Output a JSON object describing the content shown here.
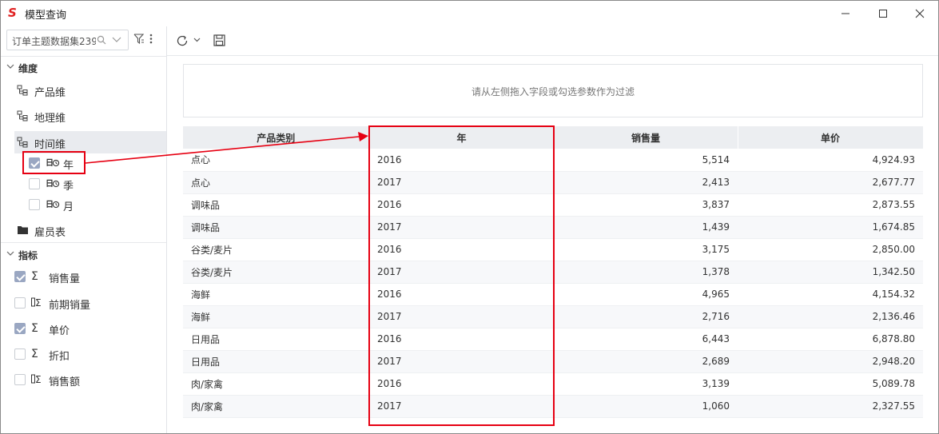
{
  "window": {
    "title": "模型查询",
    "logo_text": "S",
    "accent": "#e02020"
  },
  "left": {
    "search": {
      "value": "订单主题数据集239"
    },
    "dimensions": {
      "header": "维度",
      "items": [
        {
          "label": "产品维",
          "icon": "hierarchy-icon"
        },
        {
          "label": "地理维",
          "icon": "hierarchy-icon"
        },
        {
          "label": "时间维",
          "icon": "hierarchy-icon",
          "selected": true
        }
      ],
      "time_fields": [
        {
          "label": "年",
          "checked": true
        },
        {
          "label": "季",
          "checked": false
        },
        {
          "label": "月",
          "checked": false
        }
      ],
      "folder": {
        "label": "雇员表",
        "icon": "folder-icon"
      }
    },
    "measures": {
      "header": "指标",
      "items": [
        {
          "label": "销售量",
          "checked": true,
          "icon": "sigma-icon"
        },
        {
          "label": "前期销量",
          "checked": false,
          "icon": "calc-sigma-icon"
        },
        {
          "label": "单价",
          "checked": true,
          "icon": "sigma-icon"
        },
        {
          "label": "折扣",
          "checked": false,
          "icon": "sigma-icon"
        },
        {
          "label": "销售额",
          "checked": false,
          "icon": "calc-sigma-icon"
        }
      ]
    }
  },
  "filter": {
    "hint": "请从左侧拖入字段或勾选参数作为过滤"
  },
  "table": {
    "headers": [
      "产品类别",
      "年",
      "销售量",
      "单价"
    ],
    "rows": [
      [
        "点心",
        "2016",
        "5,514",
        "4,924.93"
      ],
      [
        "点心",
        "2017",
        "2,413",
        "2,677.77"
      ],
      [
        "调味品",
        "2016",
        "3,837",
        "2,873.55"
      ],
      [
        "调味品",
        "2017",
        "1,439",
        "1,674.85"
      ],
      [
        "谷类/麦片",
        "2016",
        "3,175",
        "2,850.00"
      ],
      [
        "谷类/麦片",
        "2017",
        "1,378",
        "1,342.50"
      ],
      [
        "海鲜",
        "2016",
        "4,965",
        "4,154.32"
      ],
      [
        "海鲜",
        "2017",
        "2,716",
        "2,136.46"
      ],
      [
        "日用品",
        "2016",
        "6,443",
        "6,878.80"
      ],
      [
        "日用品",
        "2017",
        "2,689",
        "2,948.20"
      ],
      [
        "肉/家禽",
        "2016",
        "3,139",
        "5,089.78"
      ],
      [
        "肉/家禽",
        "2017",
        "1,060",
        "2,327.55"
      ]
    ]
  },
  "annotation_color": "#e60012"
}
